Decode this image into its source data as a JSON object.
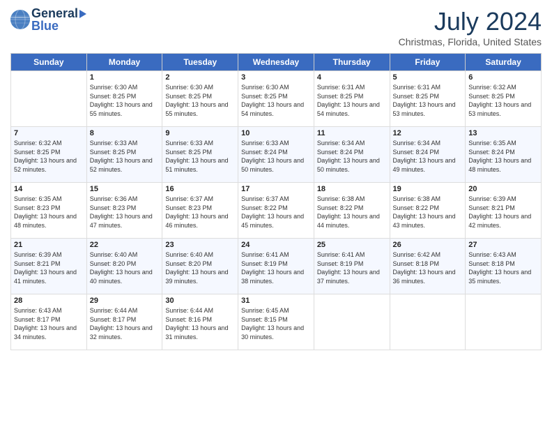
{
  "header": {
    "logo_general": "General",
    "logo_blue": "Blue",
    "month_title": "July 2024",
    "location": "Christmas, Florida, United States"
  },
  "days_of_week": [
    "Sunday",
    "Monday",
    "Tuesday",
    "Wednesday",
    "Thursday",
    "Friday",
    "Saturday"
  ],
  "weeks": [
    [
      {
        "day": "",
        "sunrise": "",
        "sunset": "",
        "daylight": ""
      },
      {
        "day": "1",
        "sunrise": "Sunrise: 6:30 AM",
        "sunset": "Sunset: 8:25 PM",
        "daylight": "Daylight: 13 hours and 55 minutes."
      },
      {
        "day": "2",
        "sunrise": "Sunrise: 6:30 AM",
        "sunset": "Sunset: 8:25 PM",
        "daylight": "Daylight: 13 hours and 55 minutes."
      },
      {
        "day": "3",
        "sunrise": "Sunrise: 6:30 AM",
        "sunset": "Sunset: 8:25 PM",
        "daylight": "Daylight: 13 hours and 54 minutes."
      },
      {
        "day": "4",
        "sunrise": "Sunrise: 6:31 AM",
        "sunset": "Sunset: 8:25 PM",
        "daylight": "Daylight: 13 hours and 54 minutes."
      },
      {
        "day": "5",
        "sunrise": "Sunrise: 6:31 AM",
        "sunset": "Sunset: 8:25 PM",
        "daylight": "Daylight: 13 hours and 53 minutes."
      },
      {
        "day": "6",
        "sunrise": "Sunrise: 6:32 AM",
        "sunset": "Sunset: 8:25 PM",
        "daylight": "Daylight: 13 hours and 53 minutes."
      }
    ],
    [
      {
        "day": "7",
        "sunrise": "Sunrise: 6:32 AM",
        "sunset": "Sunset: 8:25 PM",
        "daylight": "Daylight: 13 hours and 52 minutes."
      },
      {
        "day": "8",
        "sunrise": "Sunrise: 6:33 AM",
        "sunset": "Sunset: 8:25 PM",
        "daylight": "Daylight: 13 hours and 52 minutes."
      },
      {
        "day": "9",
        "sunrise": "Sunrise: 6:33 AM",
        "sunset": "Sunset: 8:25 PM",
        "daylight": "Daylight: 13 hours and 51 minutes."
      },
      {
        "day": "10",
        "sunrise": "Sunrise: 6:33 AM",
        "sunset": "Sunset: 8:24 PM",
        "daylight": "Daylight: 13 hours and 50 minutes."
      },
      {
        "day": "11",
        "sunrise": "Sunrise: 6:34 AM",
        "sunset": "Sunset: 8:24 PM",
        "daylight": "Daylight: 13 hours and 50 minutes."
      },
      {
        "day": "12",
        "sunrise": "Sunrise: 6:34 AM",
        "sunset": "Sunset: 8:24 PM",
        "daylight": "Daylight: 13 hours and 49 minutes."
      },
      {
        "day": "13",
        "sunrise": "Sunrise: 6:35 AM",
        "sunset": "Sunset: 8:24 PM",
        "daylight": "Daylight: 13 hours and 48 minutes."
      }
    ],
    [
      {
        "day": "14",
        "sunrise": "Sunrise: 6:35 AM",
        "sunset": "Sunset: 8:23 PM",
        "daylight": "Daylight: 13 hours and 48 minutes."
      },
      {
        "day": "15",
        "sunrise": "Sunrise: 6:36 AM",
        "sunset": "Sunset: 8:23 PM",
        "daylight": "Daylight: 13 hours and 47 minutes."
      },
      {
        "day": "16",
        "sunrise": "Sunrise: 6:37 AM",
        "sunset": "Sunset: 8:23 PM",
        "daylight": "Daylight: 13 hours and 46 minutes."
      },
      {
        "day": "17",
        "sunrise": "Sunrise: 6:37 AM",
        "sunset": "Sunset: 8:22 PM",
        "daylight": "Daylight: 13 hours and 45 minutes."
      },
      {
        "day": "18",
        "sunrise": "Sunrise: 6:38 AM",
        "sunset": "Sunset: 8:22 PM",
        "daylight": "Daylight: 13 hours and 44 minutes."
      },
      {
        "day": "19",
        "sunrise": "Sunrise: 6:38 AM",
        "sunset": "Sunset: 8:22 PM",
        "daylight": "Daylight: 13 hours and 43 minutes."
      },
      {
        "day": "20",
        "sunrise": "Sunrise: 6:39 AM",
        "sunset": "Sunset: 8:21 PM",
        "daylight": "Daylight: 13 hours and 42 minutes."
      }
    ],
    [
      {
        "day": "21",
        "sunrise": "Sunrise: 6:39 AM",
        "sunset": "Sunset: 8:21 PM",
        "daylight": "Daylight: 13 hours and 41 minutes."
      },
      {
        "day": "22",
        "sunrise": "Sunrise: 6:40 AM",
        "sunset": "Sunset: 8:20 PM",
        "daylight": "Daylight: 13 hours and 40 minutes."
      },
      {
        "day": "23",
        "sunrise": "Sunrise: 6:40 AM",
        "sunset": "Sunset: 8:20 PM",
        "daylight": "Daylight: 13 hours and 39 minutes."
      },
      {
        "day": "24",
        "sunrise": "Sunrise: 6:41 AM",
        "sunset": "Sunset: 8:19 PM",
        "daylight": "Daylight: 13 hours and 38 minutes."
      },
      {
        "day": "25",
        "sunrise": "Sunrise: 6:41 AM",
        "sunset": "Sunset: 8:19 PM",
        "daylight": "Daylight: 13 hours and 37 minutes."
      },
      {
        "day": "26",
        "sunrise": "Sunrise: 6:42 AM",
        "sunset": "Sunset: 8:18 PM",
        "daylight": "Daylight: 13 hours and 36 minutes."
      },
      {
        "day": "27",
        "sunrise": "Sunrise: 6:43 AM",
        "sunset": "Sunset: 8:18 PM",
        "daylight": "Daylight: 13 hours and 35 minutes."
      }
    ],
    [
      {
        "day": "28",
        "sunrise": "Sunrise: 6:43 AM",
        "sunset": "Sunset: 8:17 PM",
        "daylight": "Daylight: 13 hours and 34 minutes."
      },
      {
        "day": "29",
        "sunrise": "Sunrise: 6:44 AM",
        "sunset": "Sunset: 8:17 PM",
        "daylight": "Daylight: 13 hours and 32 minutes."
      },
      {
        "day": "30",
        "sunrise": "Sunrise: 6:44 AM",
        "sunset": "Sunset: 8:16 PM",
        "daylight": "Daylight: 13 hours and 31 minutes."
      },
      {
        "day": "31",
        "sunrise": "Sunrise: 6:45 AM",
        "sunset": "Sunset: 8:15 PM",
        "daylight": "Daylight: 13 hours and 30 minutes."
      },
      {
        "day": "",
        "sunrise": "",
        "sunset": "",
        "daylight": ""
      },
      {
        "day": "",
        "sunrise": "",
        "sunset": "",
        "daylight": ""
      },
      {
        "day": "",
        "sunrise": "",
        "sunset": "",
        "daylight": ""
      }
    ]
  ]
}
